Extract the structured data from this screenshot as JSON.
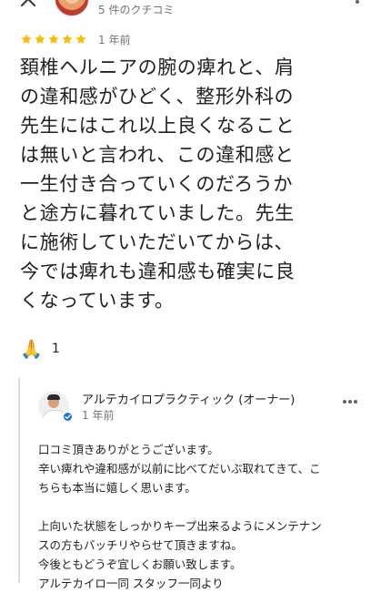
{
  "header": {
    "review_count": "5 件のクチコミ",
    "icons": [
      "back-icon",
      "reviewer-avatar",
      "more-icon"
    ]
  },
  "review": {
    "stars": 5,
    "star_color": "#fbbc04",
    "date": "1 年前",
    "lines": [
      "頚椎ヘルニアの腕の痺れと、肩",
      "の違和感がひどく、整形外科の",
      "先生にはこれ以上良くなること",
      "は無いと言われ、この違和感と",
      "一生付き合っていくのだろうか",
      "と途方に暮れていました。先生",
      "に施術していただいてからは、",
      "今では痺れも違和感も確実に良",
      "くなっています。"
    ],
    "reaction_icon": "🙏",
    "reaction_count": "1"
  },
  "owner_reply": {
    "name": "アルテカイロプラクティック (オーナー)",
    "date": "1 年前",
    "accent": "#1a73e8",
    "lines": [
      "口コミ頂きありがとうございます。",
      "辛い痺れや違和感が以前に比べてだいぶ取れてきて、こ",
      "ちらも本当に嬉しく思います。",
      "",
      "上向いた状態をしっかりキープ出来るようにメンテナン",
      "スの方もバッチリやらせて頂きますね。",
      "今後ともどうぞ宜しくお願い致します。",
      "アルテカイロ一同 スタッフ一同より"
    ]
  }
}
